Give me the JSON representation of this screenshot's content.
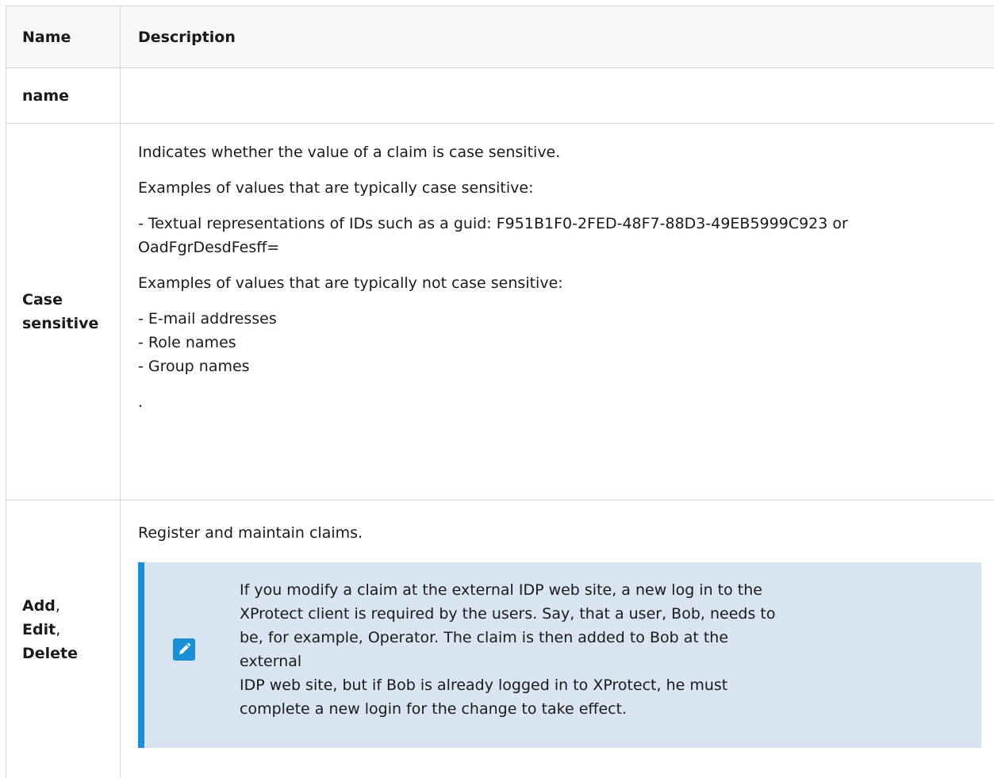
{
  "table": {
    "header": {
      "name": "Name",
      "description": "Description"
    },
    "rows": [
      {
        "name": "name",
        "description": ""
      },
      {
        "name_line1": "Case",
        "name_line2": "sensitive",
        "paragraphs": [
          "Indicates whether the value of a claim is case sensitive.",
          "Examples of values that are typically case sensitive:",
          "- Textual representations of IDs such as a guid: F951B1F0-2FED-48F7-88D3-49EB5999C923 or",
          "OadFgrDesdFesff=",
          "Examples of values that are typically not case sensitive:",
          "- E-mail addresses",
          "- Role names",
          "- Group names",
          "."
        ]
      },
      {
        "name_add": "Add",
        "name_edit": "Edit",
        "name_delete": "Delete",
        "comma": ",",
        "intro": "Register and maintain claims.",
        "note": {
          "icon": "pencil-icon",
          "lines": [
            "If you modify a claim at the external IDP web site, a new log in to the",
            "XProtect client is required by the users. Say, that a user, Bob, needs to",
            "be, for example, Operator. The claim is then added to Bob at the external",
            "IDP web site, but if Bob is already logged in to XProtect, he must",
            "complete a new login for the change to take effect."
          ]
        }
      }
    ]
  },
  "colors": {
    "note_background": "#d9e4f2",
    "note_accent": "#1b8fd4",
    "border": "#d6d6d6"
  }
}
